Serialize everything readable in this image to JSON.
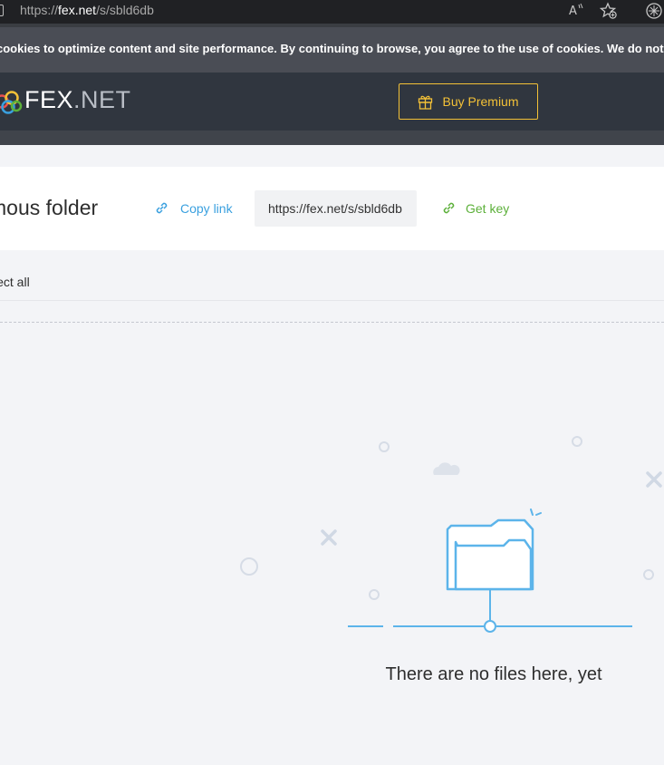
{
  "browser": {
    "url_prefix": "https://",
    "url_domain": "fex.net",
    "url_path": "/s/sbld6db",
    "icons": [
      "read-aloud-icon",
      "favorites-icon",
      "extension-icon"
    ]
  },
  "cookie_banner": {
    "text": "cookies to optimize content and site performance. By continuing to browse, you agree to the use of cookies. We do not use cook"
  },
  "header": {
    "logo_fex": "FEX",
    "logo_net": ".NET",
    "premium_label": "Buy Premium",
    "accent": "#f3c137"
  },
  "folder": {
    "title": "mous folder",
    "copy_link_label": "Copy link",
    "share_url": "https://fex.net/s/sbld6db",
    "get_key_label": "Get key"
  },
  "toolbar": {
    "select_all_label": "lect all"
  },
  "empty_state": {
    "message": "There are no files here, yet",
    "illustration": "empty-folder-illustration"
  },
  "colors": {
    "link_blue": "#3aa0df",
    "key_green": "#5cb03a",
    "illustration_blue": "#5cb4ea",
    "header_bg": "#30363f"
  }
}
